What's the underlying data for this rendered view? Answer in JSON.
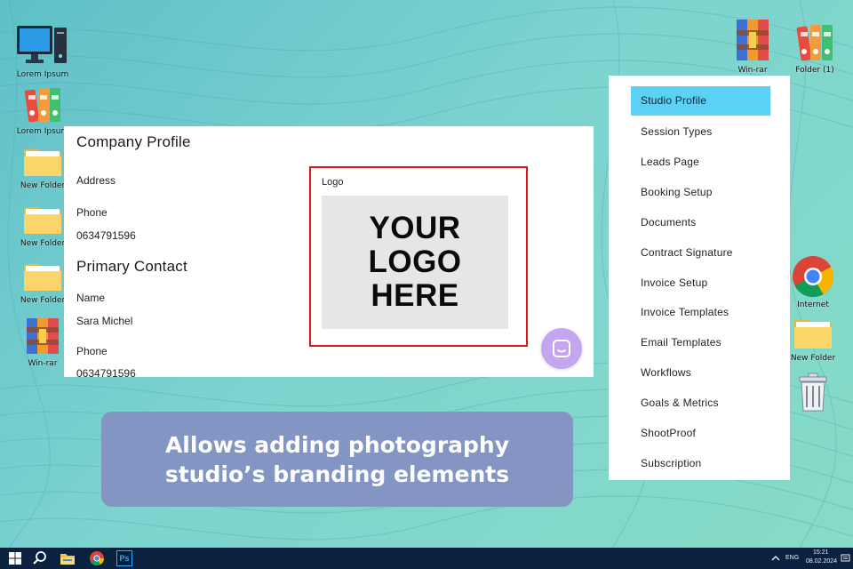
{
  "desktop": {
    "left_icons": [
      {
        "label": "Lorem Ipsum",
        "icon": "computer-icon"
      },
      {
        "label": "Lorem Ipsum",
        "icon": "binders-icon"
      },
      {
        "label": "New Folder",
        "icon": "folder-icon"
      },
      {
        "label": "New Folder",
        "icon": "folder-icon"
      },
      {
        "label": "New Folder",
        "icon": "folder-icon"
      },
      {
        "label": "Win-rar",
        "icon": "winrar-icon"
      }
    ],
    "right_icons": [
      {
        "label": "Win-rar",
        "icon": "winrar-icon"
      },
      {
        "label": "Folder (1)",
        "icon": "binders-icon"
      },
      {
        "label": "Internet",
        "icon": "chrome-icon"
      },
      {
        "label": "New Folder",
        "icon": "folder-icon"
      },
      {
        "label": "",
        "icon": "recycle-bin-icon"
      }
    ]
  },
  "profile": {
    "company_title": "Company Profile",
    "address_label": "Address",
    "phone_label": "Phone",
    "phone_value": "0634791596",
    "primary_contact_title": "Primary Contact",
    "name_label": "Name",
    "name_value": "Sara Michel",
    "contact_phone_label": "Phone",
    "contact_phone_value": "0634791596",
    "logo_label": "Logo",
    "logo_placeholder": "YOUR\nLOGO\nHERE"
  },
  "menu": {
    "items": [
      {
        "label": "Studio Profile",
        "active": true
      },
      {
        "label": "Session Types",
        "active": false
      },
      {
        "label": "Leads Page",
        "active": false
      },
      {
        "label": "Booking Setup",
        "active": false
      },
      {
        "label": "Documents",
        "active": false
      },
      {
        "label": "Contract Signature",
        "active": false
      },
      {
        "label": "Invoice Setup",
        "active": false
      },
      {
        "label": "Invoice Templates",
        "active": false
      },
      {
        "label": "Email Templates",
        "active": false
      },
      {
        "label": "Workflows",
        "active": false
      },
      {
        "label": "Goals & Metrics",
        "active": false
      },
      {
        "label": "ShootProof",
        "active": false
      },
      {
        "label": "Subscription",
        "active": false
      }
    ],
    "active_color": "#5ad1f5"
  },
  "caption": {
    "text": "Allows adding photography\nstudio’s branding elements"
  },
  "taskbar": {
    "icons": [
      "windows-start-icon",
      "search-icon",
      "file-explorer-icon",
      "chrome-icon",
      "photoshop-icon"
    ],
    "photoshop_label": "Ps",
    "language": "ENG",
    "time": "15:21",
    "date": "08.02.2024"
  },
  "colors": {
    "highlight_border": "#e0141c",
    "chat_button": "#c4a6ee",
    "taskbar": "#0a2240"
  }
}
